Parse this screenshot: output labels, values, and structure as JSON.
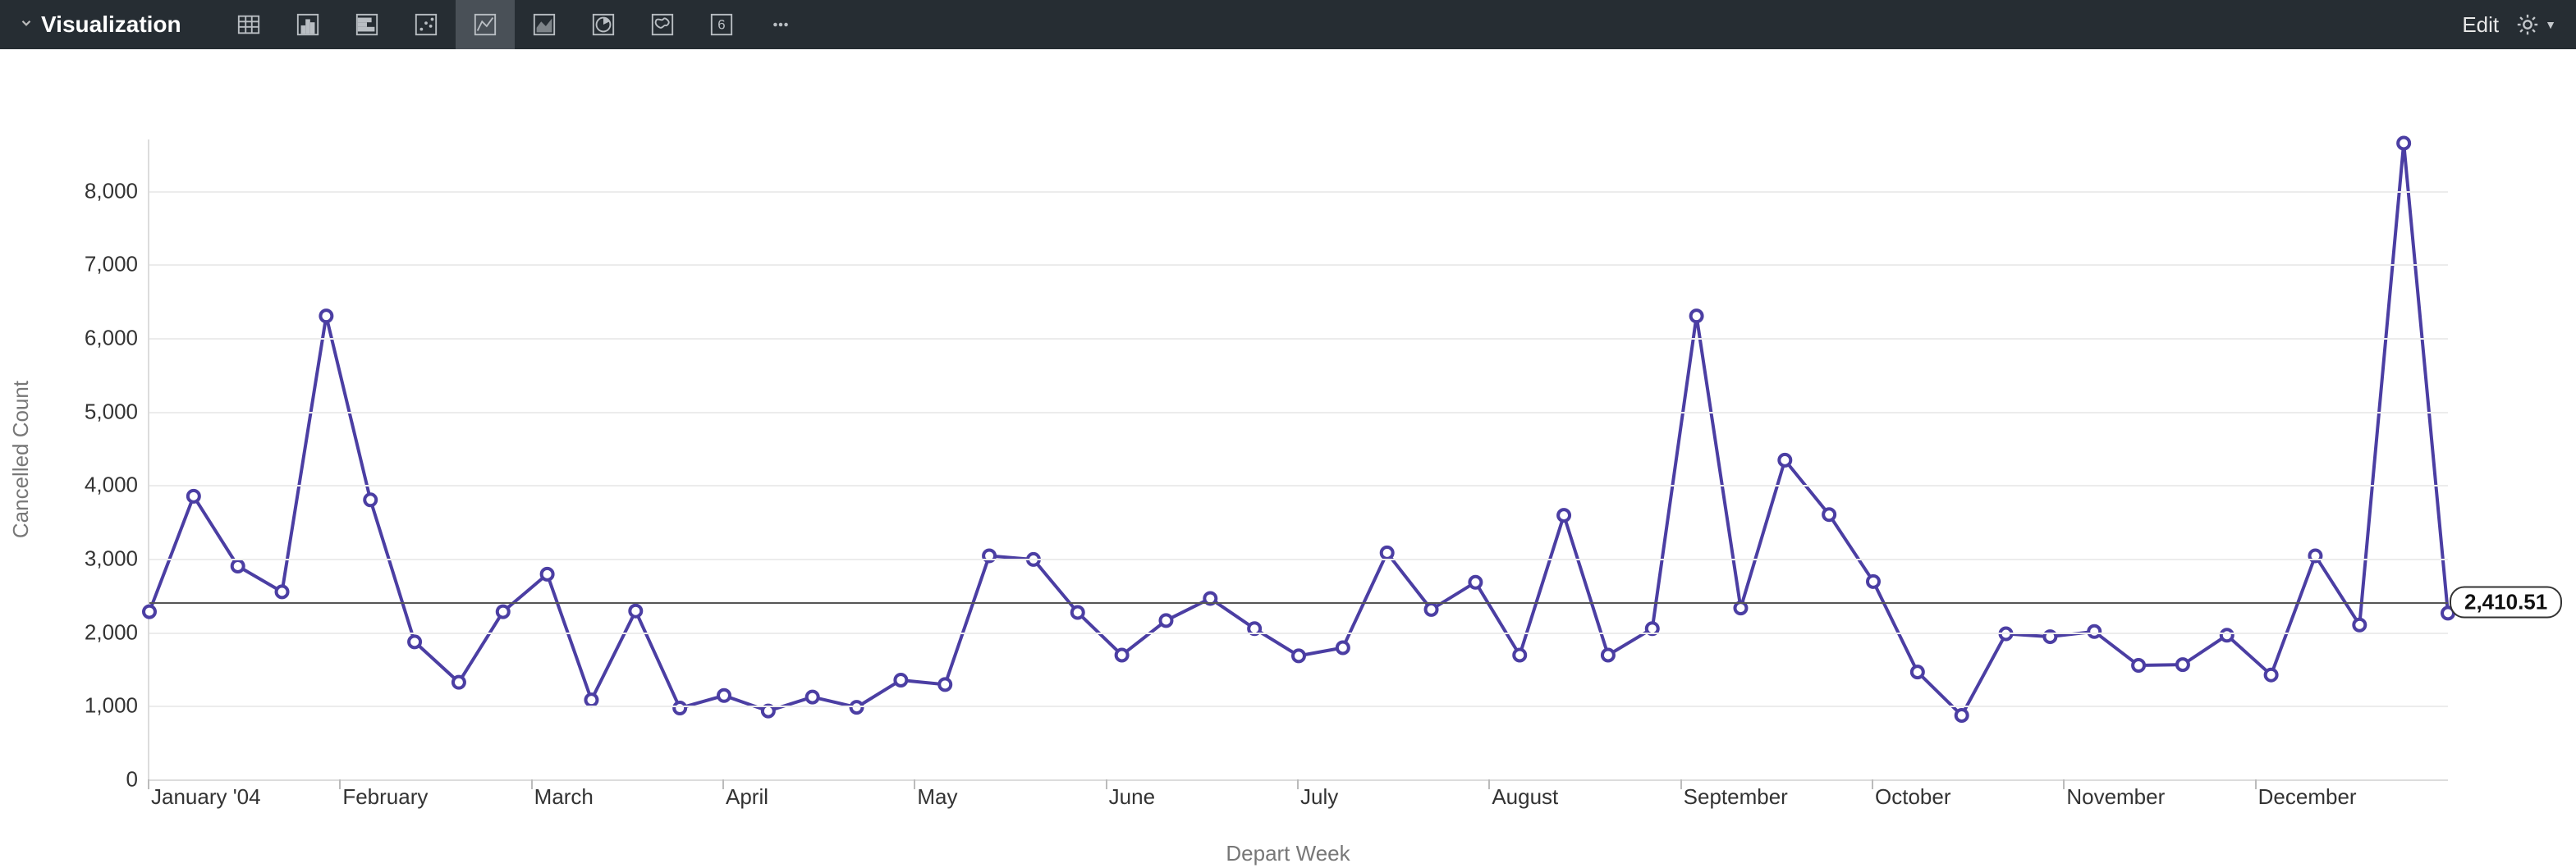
{
  "toolbar": {
    "title": "Visualization",
    "edit_label": "Edit",
    "icons": [
      {
        "name": "table-icon",
        "active": false
      },
      {
        "name": "column-chart-icon",
        "active": false
      },
      {
        "name": "bar-chart-icon",
        "active": false
      },
      {
        "name": "scatter-chart-icon",
        "active": false
      },
      {
        "name": "line-chart-icon",
        "active": true
      },
      {
        "name": "area-chart-icon",
        "active": false
      },
      {
        "name": "pie-chart-icon",
        "active": false
      },
      {
        "name": "map-chart-icon",
        "active": false
      },
      {
        "name": "single-value-icon",
        "active": false
      },
      {
        "name": "more-icon",
        "active": false
      }
    ]
  },
  "chart_data": {
    "type": "line",
    "title": "",
    "xlabel": "Depart Week",
    "ylabel": "Cancelled Count",
    "ylim": [
      0,
      8700
    ],
    "y_ticks": [
      0,
      1000,
      2000,
      3000,
      4000,
      5000,
      6000,
      7000,
      8000
    ],
    "y_tick_labels": [
      "0",
      "1,000",
      "2,000",
      "3,000",
      "4,000",
      "5,000",
      "6,000",
      "7,000",
      "8,000"
    ],
    "x_month_labels": [
      "January '04",
      "February",
      "March",
      "April",
      "May",
      "June",
      "July",
      "August",
      "September",
      "October",
      "November",
      "December"
    ],
    "reference_line": {
      "value": 2410.51,
      "label": "2,410.51"
    },
    "series": [
      {
        "name": "Cancelled Count",
        "color": "#4b3ea3",
        "values": [
          2280,
          3850,
          2900,
          2550,
          6300,
          3800,
          1870,
          1320,
          2280,
          2790,
          1080,
          2290,
          970,
          1140,
          930,
          1120,
          980,
          1350,
          1290,
          3040,
          2990,
          2270,
          1690,
          2160,
          2460,
          2050,
          1680,
          1790,
          3080,
          2310,
          2680,
          1690,
          3590,
          1690,
          2050,
          6300,
          2330,
          4340,
          3600,
          2690,
          1460,
          870,
          1980,
          1940,
          2010,
          1550,
          1560,
          1960,
          1420,
          3040,
          2100,
          8650,
          2260
        ]
      }
    ]
  }
}
